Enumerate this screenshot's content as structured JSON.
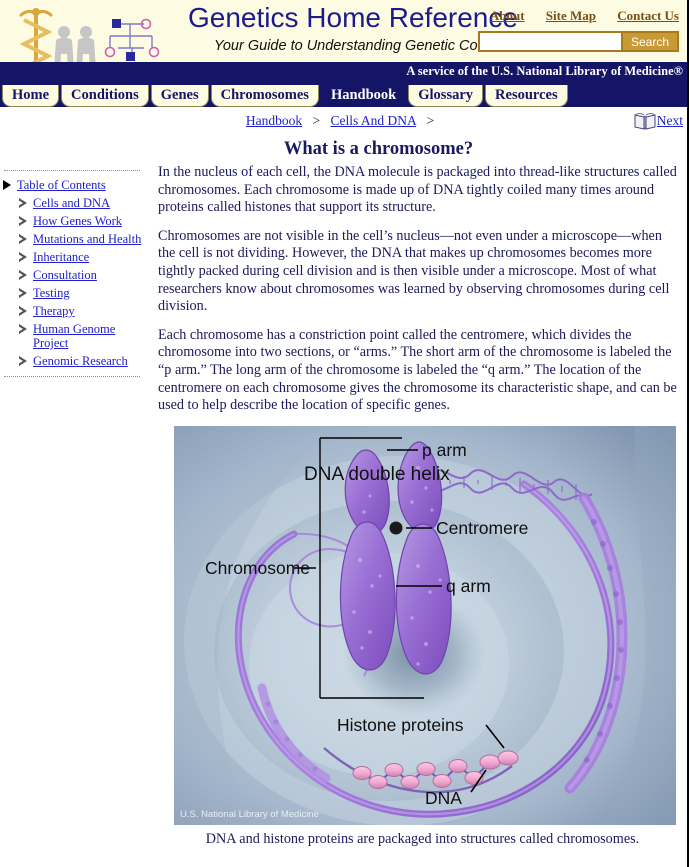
{
  "header": {
    "site_title": "Genetics Home Reference",
    "tagline": "Your Guide to Understanding Genetic Conditions",
    "logo_icon": "caduceus-pedigree-dna-logo",
    "top_links": [
      {
        "label": "About"
      },
      {
        "label": "Site Map"
      },
      {
        "label": "Contact Us"
      }
    ],
    "search": {
      "value": "",
      "placeholder": "",
      "button_label": "Search",
      "icon": "search-icon"
    },
    "service_line": "A service of the U.S. National Library of Medicine®"
  },
  "nav": {
    "tabs": [
      {
        "label": "Home",
        "active": false
      },
      {
        "label": "Conditions",
        "active": false
      },
      {
        "label": "Genes",
        "active": false
      },
      {
        "label": "Chromosomes",
        "active": false
      },
      {
        "label": "Handbook",
        "active": true
      },
      {
        "label": "Glossary",
        "active": false
      },
      {
        "label": "Resources",
        "active": false
      }
    ]
  },
  "breadcrumb": {
    "items": [
      {
        "label": "Handbook"
      },
      {
        "label": "Cells And DNA"
      }
    ],
    "separator": ">",
    "trailing_separator": ">"
  },
  "next_link": {
    "label": "Next",
    "icon": "open-book-icon"
  },
  "page": {
    "title": "What is a chromosome?",
    "paragraphs": [
      "In the nucleus of each cell, the DNA molecule is packaged into thread-like structures called chromosomes. Each chromosome is made up of DNA tightly coiled many times around proteins called histones that support its structure.",
      "Chromosomes are not visible in the cell’s nucleus—not even under a microscope—when the cell is not dividing. However, the DNA that makes up chromosomes becomes more tightly packed during cell division and is then visible under a microscope. Most of what researchers know about chromosomes was learned by observing chromosomes during cell division.",
      "Each chromosome has a constriction point called the centromere, which divides the chromosome into two sections, or “arms.” The short arm of the chromosome is labeled the “p arm.” The long arm of the chromosome is labeled the “q arm.” The location of the centromere on each chromosome gives the chromosome its characteristic shape, and can be used to help describe the location of specific genes."
    ],
    "figure": {
      "labels": {
        "dna_double_helix": "DNA double helix",
        "p_arm": "p arm",
        "centromere": "Centromere",
        "q_arm": "q arm",
        "chromosome": "Chromosome",
        "histone_proteins": "Histone proteins",
        "dna": "DNA"
      },
      "credit": "U.S. National Library of Medicine",
      "caption": "DNA and histone proteins are packaged into structures called chromosomes."
    }
  },
  "sidebar": {
    "items": [
      {
        "label": "Table of Contents",
        "level": 0,
        "marker": "solid-triangle-icon"
      },
      {
        "label": "Cells and DNA",
        "level": 1,
        "marker": "hollow-triangle-icon"
      },
      {
        "label": "How Genes Work",
        "level": 1,
        "marker": "hollow-triangle-icon"
      },
      {
        "label": "Mutations and Health",
        "level": 1,
        "marker": "hollow-triangle-icon"
      },
      {
        "label": "Inheritance",
        "level": 1,
        "marker": "hollow-triangle-icon"
      },
      {
        "label": "Consultation",
        "level": 1,
        "marker": "hollow-triangle-icon"
      },
      {
        "label": "Testing",
        "level": 1,
        "marker": "hollow-triangle-icon"
      },
      {
        "label": "Therapy",
        "level": 1,
        "marker": "hollow-triangle-icon"
      },
      {
        "label": "Human Genome Project",
        "level": 1,
        "marker": "hollow-triangle-icon"
      },
      {
        "label": "Genomic Research",
        "level": 1,
        "marker": "hollow-triangle-icon"
      }
    ]
  },
  "colors": {
    "header_bg": "#fdfbe2",
    "nav_bg": "#151568",
    "tab_bg": "#fdfbe2",
    "title_blue": "#1b1b8f",
    "link_blue": "#2020cc",
    "toplink_brown": "#7a4f14",
    "search_button": "#c99a33",
    "body_text": "#1a1a5e",
    "figure_bg": "#8fa3bb",
    "chromosome_purple": "#9a6fd4",
    "histone_pink": "#f0a8d0"
  }
}
